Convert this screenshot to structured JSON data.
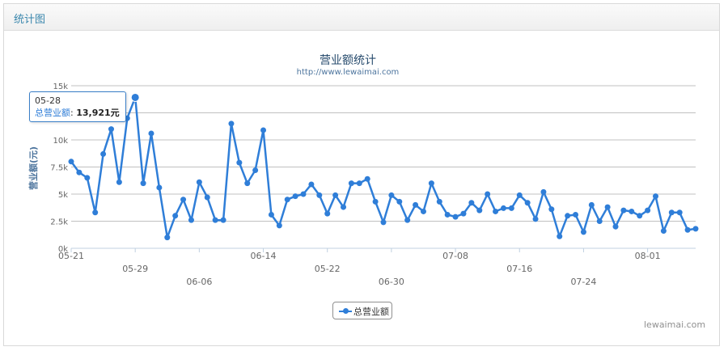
{
  "panel": {
    "title": "统计图"
  },
  "chart_data": {
    "type": "line",
    "title": "营业额统计",
    "subtitle": "http://www.lewaimai.com",
    "ylabel": "营业额(元)",
    "xlabel": "",
    "ylim": [
      0,
      15000
    ],
    "yticks": [
      0,
      2500,
      5000,
      7500,
      10000,
      12500,
      15000
    ],
    "ytick_labels": [
      "0k",
      "2.5k",
      "5k",
      "7.5k",
      "10k",
      "12.5k",
      "15k"
    ],
    "grid": true,
    "xtick_labels": [
      {
        "label": "05-21",
        "index": 0
      },
      {
        "label": "05-29",
        "index": 8
      },
      {
        "label": "06-06",
        "index": 16
      },
      {
        "label": "06-14",
        "index": 24
      },
      {
        "label": "05-22",
        "index": 32
      },
      {
        "label": "06-30",
        "index": 40
      },
      {
        "label": "07-08",
        "index": 48
      },
      {
        "label": "07-16",
        "index": 56
      },
      {
        "label": "07-24",
        "index": 64
      },
      {
        "label": "08-01",
        "index": 72
      }
    ],
    "series": [
      {
        "name": "总营业额",
        "color": "#2f7ed8",
        "values": [
          8000,
          7000,
          6500,
          3300,
          8700,
          11000,
          6100,
          12000,
          13921,
          6000,
          10600,
          5600,
          1000,
          3000,
          4500,
          2600,
          6100,
          4700,
          2600,
          2600,
          11500,
          7900,
          6000,
          7200,
          10900,
          3100,
          2100,
          4500,
          4800,
          5000,
          5900,
          4900,
          3200,
          4900,
          3800,
          6000,
          6000,
          6400,
          4300,
          2400,
          4900,
          4300,
          2600,
          4000,
          3400,
          6000,
          4300,
          3100,
          2900,
          3200,
          4200,
          3500,
          5000,
          3400,
          3700,
          3700,
          4900,
          4200,
          2700,
          5200,
          3600,
          1100,
          3000,
          3100,
          1500,
          4000,
          2500,
          3800,
          2000,
          3500,
          3400,
          3000,
          3500,
          4800,
          1600,
          3300,
          3300,
          1700,
          1800
        ]
      }
    ],
    "tooltip": {
      "date": "05-28",
      "series": "总营业额",
      "value": "13,921元",
      "index": 8
    },
    "credit": "lewaimai.com"
  }
}
